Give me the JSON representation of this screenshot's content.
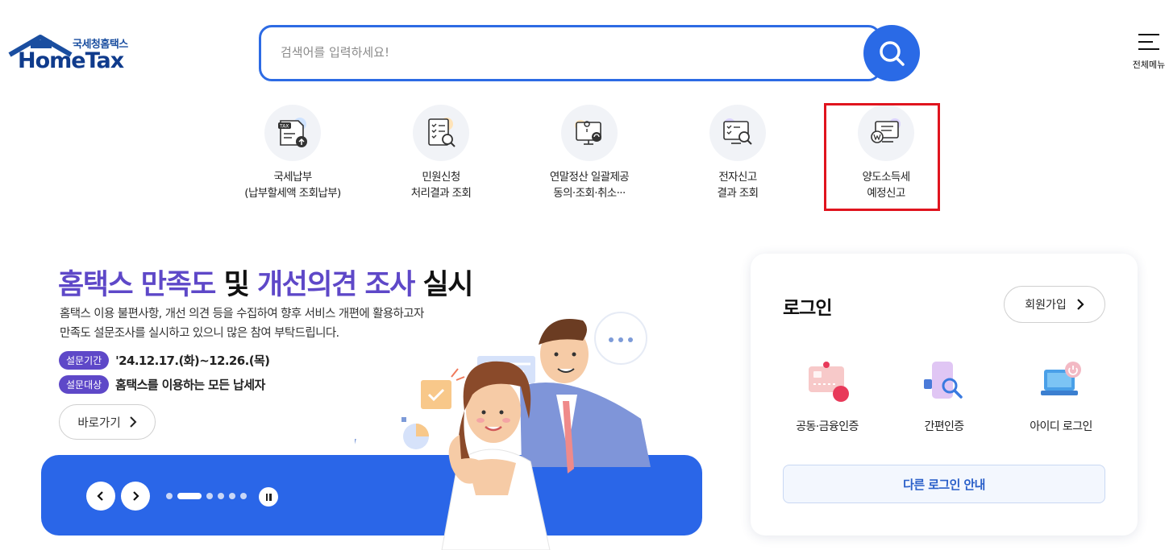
{
  "header": {
    "logo_sub": "국세청홈택스",
    "logo_main": "HomeTax",
    "search_placeholder": "검색어를 입력하세요!",
    "all_menu_label": "전체메뉴"
  },
  "quick_menu": [
    {
      "line1": "국세납부",
      "line2": "(납부할세액 조회납부)",
      "icon": "tax-payment-icon"
    },
    {
      "line1": "민원신청",
      "line2": "처리결과 조회",
      "icon": "document-search-icon"
    },
    {
      "line1": "연말정산 일괄제공",
      "line2": "동의·조회·취소···",
      "icon": "monitor-location-icon"
    },
    {
      "line1": "전자신고",
      "line2": "결과 조회",
      "icon": "monitor-search-icon"
    },
    {
      "line1": "양도소득세",
      "line2": "예정신고",
      "icon": "monitor-won-icon"
    }
  ],
  "banner": {
    "title_part1": "홈택스 만족도",
    "title_part2": "및",
    "title_part3": "개선의견 조사",
    "title_part4": "실시",
    "desc_line1": "홈택스 이용 불편사항, 개선 의견 등을 수집하여 향후 서비스 개편에 활용하고자",
    "desc_line2": "만족도 설문조사를 실시하고 있으니 많은 참여 부탁드립니다.",
    "period_tag": "설문기간",
    "period_text": "'24.12.17.(화)~12.26.(목)",
    "target_tag": "설문대상",
    "target_text": "홈택스를 이용하는 모든 납세자",
    "go_label": "바로가기",
    "slide_count": 6,
    "active_slide": 1
  },
  "login": {
    "title": "로그인",
    "signup_label": "회원가입",
    "options": [
      {
        "label": "공동·금융인증",
        "icon": "certificate-icon"
      },
      {
        "label": "간편인증",
        "icon": "phone-auth-icon"
      },
      {
        "label": "아이디 로그인",
        "icon": "laptop-login-icon"
      }
    ],
    "other_login_label": "다른 로그인 안내"
  },
  "colors": {
    "primary_blue": "#2a66e8",
    "purple": "#5e48c8",
    "highlight_red": "#e0141e",
    "logo_navy": "#0f3b8c"
  }
}
